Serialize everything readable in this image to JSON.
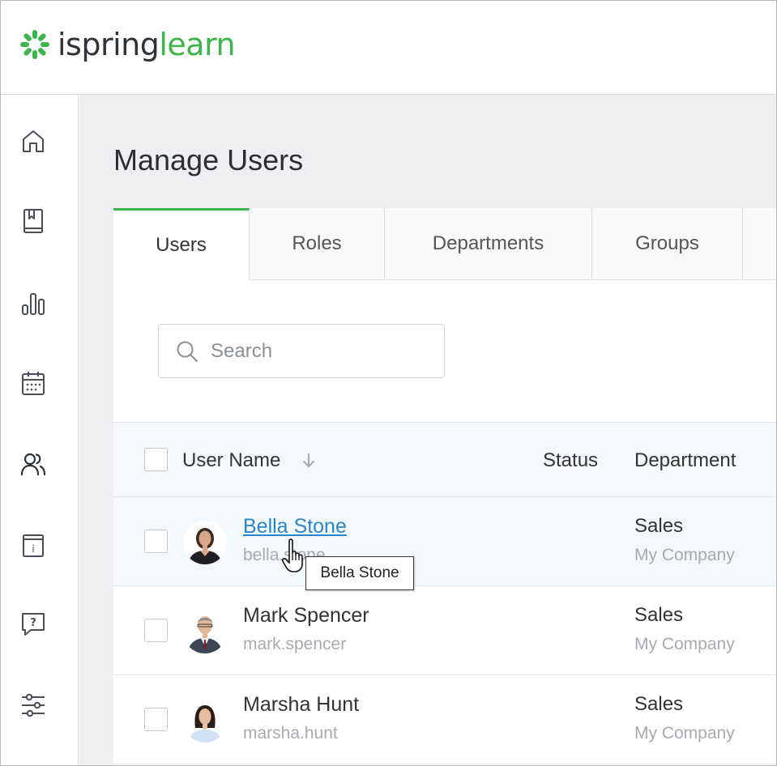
{
  "brand": {
    "name_part1": "ispring",
    "name_part2": "learn",
    "accent": "#3cb64b"
  },
  "sidebar": {
    "items": [
      {
        "icon": "home-icon"
      },
      {
        "icon": "book-icon"
      },
      {
        "icon": "bar-chart-icon"
      },
      {
        "icon": "calendar-icon"
      },
      {
        "icon": "users-icon"
      },
      {
        "icon": "info-box-icon"
      },
      {
        "icon": "help-chat-icon"
      },
      {
        "icon": "sliders-icon"
      }
    ]
  },
  "page": {
    "title": "Manage Users"
  },
  "tabs": [
    {
      "label": "Users",
      "active": true
    },
    {
      "label": "Roles",
      "active": false
    },
    {
      "label": "Departments",
      "active": false
    },
    {
      "label": "Groups",
      "active": false
    }
  ],
  "search": {
    "placeholder": "Search"
  },
  "table": {
    "columns": {
      "user_name": "User Name",
      "status": "Status",
      "department": "Department"
    },
    "rows": [
      {
        "name": "Bella Stone",
        "login": "bella.stone",
        "department": "Sales",
        "company": "My Company"
      },
      {
        "name": "Mark Spencer",
        "login": "mark.spencer",
        "department": "Sales",
        "company": "My Company"
      },
      {
        "name": "Marsha Hunt",
        "login": "marsha.hunt",
        "department": "Sales",
        "company": "My Company"
      }
    ]
  },
  "tooltip": {
    "text": "Bella Stone"
  }
}
